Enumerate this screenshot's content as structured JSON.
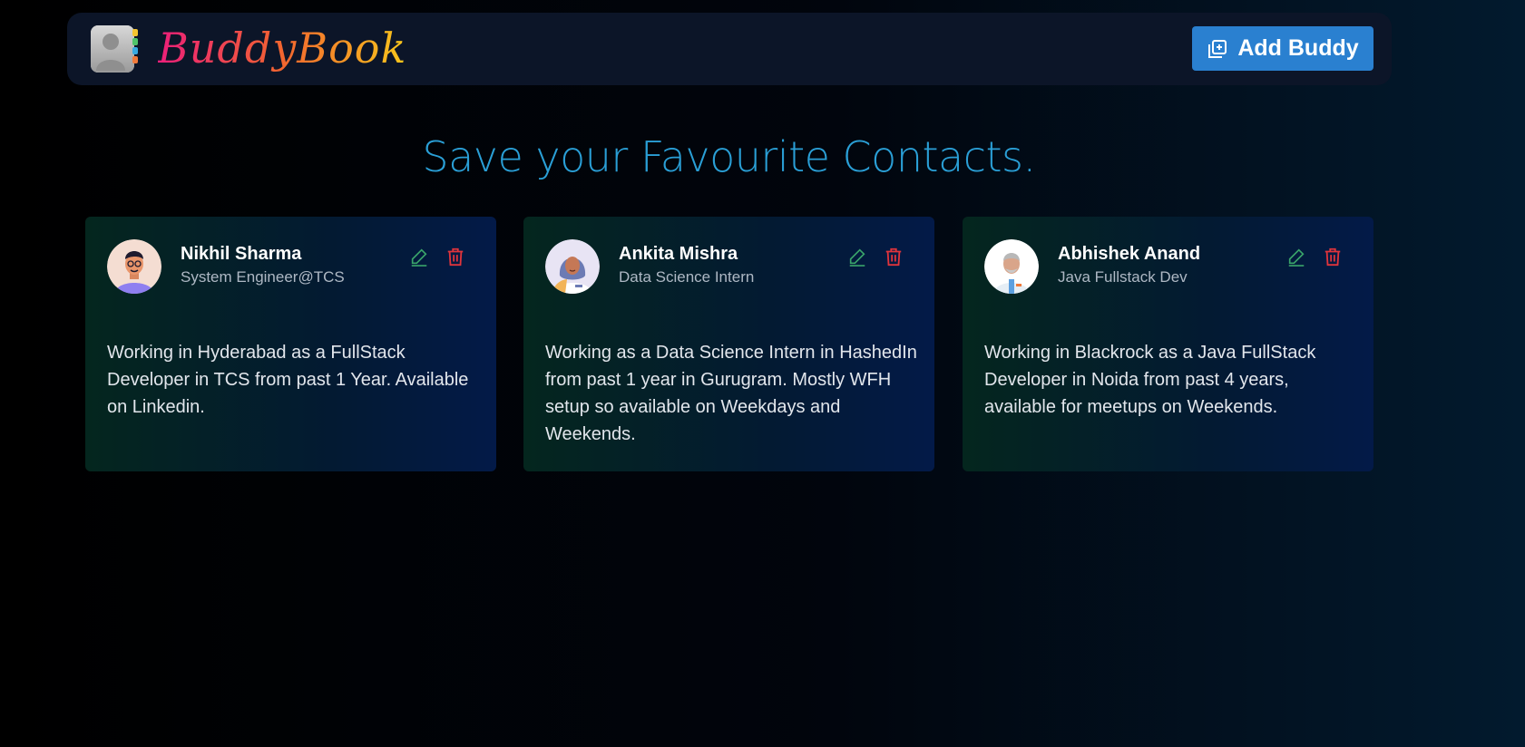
{
  "navbar": {
    "logo_icon": "contact-book-icon",
    "brand": "BuddyBook",
    "add_button_label": "Add Buddy",
    "add_button_icon": "add-box-icon"
  },
  "heading": "Save your Favourite Contacts.",
  "contacts": [
    {
      "name": "Nikhil Sharma",
      "role": "System Engineer@TCS",
      "description": "Working in Hyderabad as a FullStack Developer in TCS from past 1 Year. Available on Linkedin.",
      "avatar_icon": "man-avatar-icon"
    },
    {
      "name": "Ankita Mishra",
      "role": "Data Science Intern",
      "description": "Working as a Data Science Intern in HashedIn from past 1 year in Gurugram. Mostly WFH setup so available on Weekdays and Weekends.",
      "avatar_icon": "woman-hijab-avatar-icon"
    },
    {
      "name": "Abhishek Anand",
      "role": "Java Fullstack Dev",
      "description": "Working in Blackrock as a Java FullStack Developer in Noida from past 4 years, available for meetups on Weekends.",
      "avatar_icon": "doctor-avatar-icon"
    }
  ],
  "colors": {
    "accent": "#2a80d0",
    "heading": "#2a9fd6",
    "edit": "#3aa46a",
    "delete": "#e0343c"
  }
}
